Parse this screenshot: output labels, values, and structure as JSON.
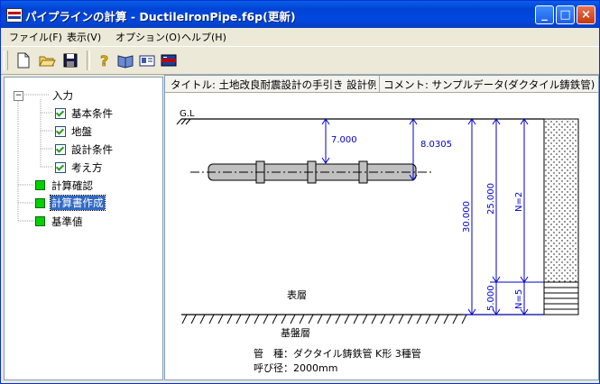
{
  "window": {
    "title": "パイプラインの計算 - DuctileIronPipe.f6p(更新)"
  },
  "titlebar_buttons": {
    "minimize": "_",
    "maximize": "□",
    "close": "×"
  },
  "menu": [
    "ファイル(F)",
    "表示(V)",
    "オプション(O)",
    "ヘルプ(H)"
  ],
  "toolbar_icons": [
    "new-file-icon",
    "open-folder-icon",
    "save-icon",
    "help-icon",
    "book-icon",
    "card-icon",
    "flag-icon"
  ],
  "tree": {
    "root": "入力",
    "children": [
      "基本条件",
      "地盤",
      "設計条件",
      "考え方"
    ],
    "items": [
      "計算確認",
      "計算書作成",
      "基準値"
    ]
  },
  "info": {
    "title_label": "タイトル: 土地改良耐震設計の手引き 設計例",
    "comment_label": "コメント: サンプルデータ(ダクタイル鋳鉄管)"
  },
  "drawing": {
    "gl": "G.L",
    "depth_to_pipe": "7.000",
    "depth_to_pipe_bottom": "8.0305",
    "total_depth": "30.000",
    "upper_depth": "25.000",
    "lower_depth": "5.000",
    "n_upper": "N=2",
    "n_lower": "N=5",
    "surface_layer": "表層",
    "base_layer": "基盤層",
    "pipe_type": "管　種：ダクタイル鋳鉄管 K形 3種管",
    "nominal_dia": "呼び径：2000mm"
  },
  "colors": {
    "dimension": "#0000CC",
    "pipe_fill": "#C0C0C0",
    "selected": "#316AC5",
    "tree_square": "#00D000"
  }
}
